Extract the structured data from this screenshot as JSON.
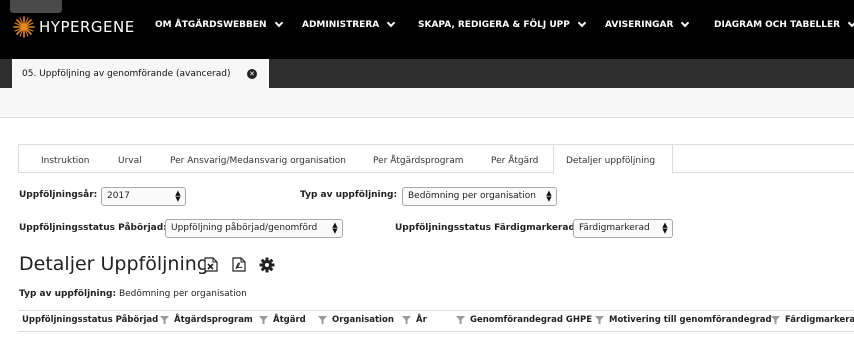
{
  "app": {
    "brand": "HYPERGENE"
  },
  "nav": [
    {
      "label": "OM ÅTGÄRDSWEBBEN"
    },
    {
      "label": "ADMINISTRERA"
    },
    {
      "label": "SKAPA, REDIGERA & FÖLJ UPP"
    },
    {
      "label": "AVISERINGAR"
    },
    {
      "label": "DIAGRAM OCH TABELLER"
    }
  ],
  "open_tab": {
    "label": "05. Uppföljning av genomförande (avancerad)"
  },
  "tabs": [
    {
      "label": "Instruktion"
    },
    {
      "label": "Urval"
    },
    {
      "label": "Per Ansvarig/Medansvarig organisation"
    },
    {
      "label": "Per Åtgärdsprogram"
    },
    {
      "label": "Per Åtgärd"
    },
    {
      "label": "Detaljer uppföljning",
      "active": true
    }
  ],
  "filters": {
    "year": {
      "label": "Uppföljningsår:",
      "value": "2017"
    },
    "type": {
      "label": "Typ av uppföljning:",
      "value": "Bedömning per organisation"
    },
    "status_started": {
      "label": "Uppföljningsstatus Påbörjad:",
      "value": "Uppföljning påbörjad/genomförd"
    },
    "status_finished": {
      "label": "Uppföljningsstatus Färdigmarkerad:",
      "value": "Färdigmarkerad"
    }
  },
  "report": {
    "title": "Detaljer Uppföljning",
    "subtitle_label": "Typ av uppföljning:",
    "subtitle_value": "Bedömning per organisation"
  },
  "columns": [
    {
      "label": "Uppföljningsstatus Påbörjad"
    },
    {
      "label": "Åtgärdsprogram"
    },
    {
      "label": "Åtgärd"
    },
    {
      "label": "Organisation"
    },
    {
      "label": "År"
    },
    {
      "label": "Genomförandegrad GHPE"
    },
    {
      "label": "Motivering till genomförandegrad"
    },
    {
      "label": "Färdigmarkerad"
    }
  ],
  "icons": {
    "excel": "excel-export-icon",
    "pdf": "pdf-export-icon",
    "settings": "gear-icon",
    "filter": "filter-icon"
  },
  "colors": {
    "topbar": "#000000",
    "tabstrip": "#2e2e2e",
    "logo_orange": "#e8871e"
  }
}
